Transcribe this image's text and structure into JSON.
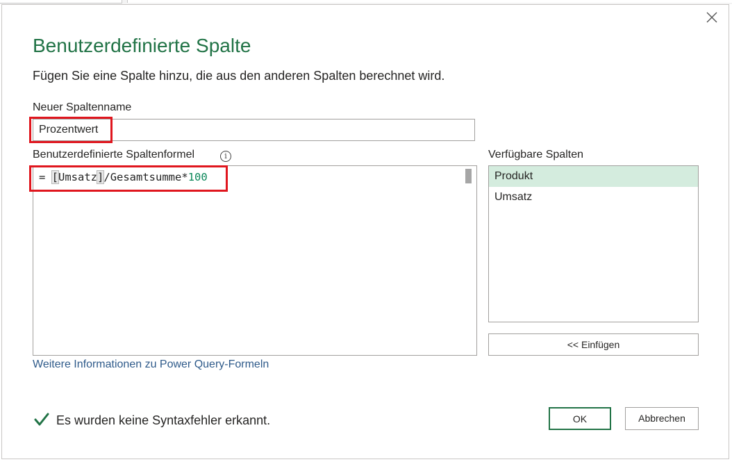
{
  "dialog": {
    "title": "Benutzerdefinierte Spalte",
    "subtitle": "Fügen Sie eine Spalte hinzu, die aus den anderen Spalten berechnet wird.",
    "close_icon": "close-icon"
  },
  "column_name": {
    "label": "Neuer Spaltenname",
    "value": "Prozentwert"
  },
  "formula": {
    "label": "Benutzerdefinierte Spaltenformel",
    "info_icon": "info-icon",
    "prefix": "= ",
    "open_bracket": "[",
    "column_ref": "Umsatz",
    "close_bracket": "]",
    "operator_text": "/Gesamtsumme*",
    "number": "100"
  },
  "available_columns": {
    "label": "Verfügbare Spalten",
    "items": [
      {
        "label": "Produkt",
        "selected": true
      },
      {
        "label": "Umsatz",
        "selected": false
      }
    ]
  },
  "buttons": {
    "insert": "<< Einfügen",
    "ok": "OK",
    "cancel": "Abbrechen"
  },
  "link": "Weitere Informationen zu Power Query-Formeln",
  "status": {
    "icon": "checkmark-icon",
    "text": "Es wurden keine Syntaxfehler erkannt."
  },
  "colors": {
    "accent": "#217346",
    "highlight_box": "#e0161e",
    "selected_item": "#d4ecde",
    "link": "#2e5a8a",
    "number_literal": "#098658"
  }
}
